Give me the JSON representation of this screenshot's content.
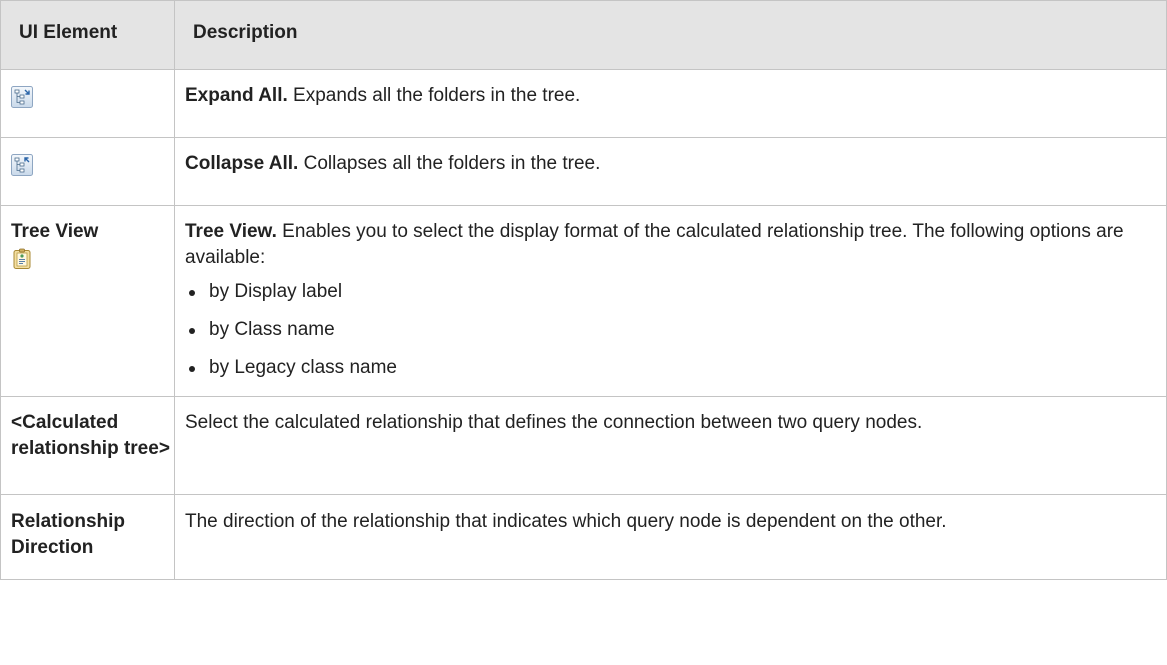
{
  "table": {
    "header": {
      "col1": "UI Element",
      "col2": "Description"
    },
    "rows": [
      {
        "element_icon": "expand-all-icon",
        "title": "Expand All.",
        "text": " Expands all the folders in the tree."
      },
      {
        "element_icon": "collapse-all-icon",
        "title": "Collapse All.",
        "text": " Collapses all the folders in the tree."
      },
      {
        "element_label": "Tree View",
        "element_icon": "tree-view-icon",
        "title": "Tree View.",
        "text": " Enables you to select the display format of the calculated relationship tree. The following options are available:",
        "options": [
          "by Display label",
          "by Class name",
          "by Legacy class name"
        ]
      },
      {
        "element_label": "<Calculated relationship tree>",
        "text": "Select the calculated relationship that defines the connection between two query nodes."
      },
      {
        "element_label": "Relationship Direction",
        "text": "The direction of the relationship that indicates which query node is dependent on the other."
      }
    ]
  }
}
